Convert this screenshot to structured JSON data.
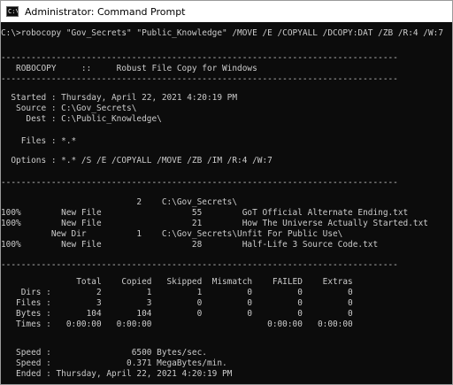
{
  "window": {
    "title": "Administrator: Command Prompt",
    "icon": "cmd-icon",
    "icon_text": "C:\\"
  },
  "console": {
    "lines": [
      "C:\\>robocopy \"Gov_Secrets\" \"Public_Knowledge\" /MOVE /E /COPYALL /DCOPY:DAT /ZB /R:4 /W:7",
      "-------------------------------------------------------------------------------",
      "   ROBOCOPY     ::     Robust File Copy for Windows",
      "-------------------------------------------------------------------------------",
      "  Started : Thursday, April 22, 2021 4:20:19 PM",
      "   Source : C:\\Gov_Secrets\\",
      "     Dest : C:\\Public_Knowledge\\",
      "    Files : *.*",
      "  Options : *.* /S /E /COPYALL /MOVE /ZB /IM /R:4 /W:7",
      "-------------------------------------------------------------------------------",
      "                           2    C:\\Gov_Secrets\\",
      "100%        New File                  55        GoT Official Alternate Ending.txt",
      "100%        New File                  21        How The Universe Actually Started.txt",
      "          New Dir          1    C:\\Gov_Secrets\\Unfit For Public Use\\",
      "100%        New File                  28        Half-Life 3 Source Code.txt",
      "-------------------------------------------------------------------------------",
      "               Total    Copied   Skipped  Mismatch    FAILED    Extras",
      "    Dirs :         2         1         1         0         0         0",
      "   Files :         3         3         0         0         0         0",
      "   Bytes :       104       104         0         0         0         0",
      "   Times :   0:00:00   0:00:00                       0:00:00   0:00:00",
      "   Speed :                6500 Bytes/sec.",
      "   Speed :               0.371 MegaBytes/min.",
      "   Ended : Thursday, April 22, 2021 4:20:19 PM"
    ]
  },
  "colors": {
    "console_background": "#0c0c0c",
    "console_text": "#cccccc",
    "titlebar_background": "#ffffff",
    "titlebar_text": "#000000"
  }
}
